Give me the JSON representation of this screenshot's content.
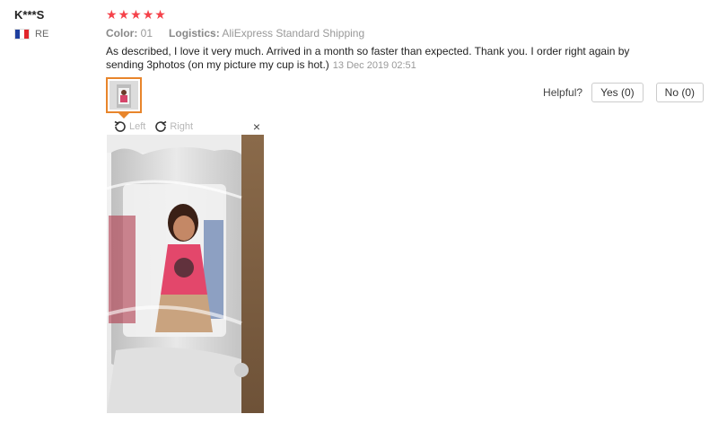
{
  "review": {
    "reviewer_name": "K***S",
    "country_code": "RE",
    "flag_colors": [
      "#1f3f9e",
      "#ffffff",
      "#e1252b"
    ],
    "rating": 5,
    "stars": [
      "★",
      "★",
      "★",
      "★",
      "★"
    ],
    "star_color": "#f5424a",
    "color_label": "Color:",
    "color_value": "01",
    "logistics_label": "Logistics:",
    "logistics_value": "AliExpress Standard Shipping",
    "feedback_text": "As described, I love it very much. Arrived in a month so faster than expected. Thank you. I order right again by sending 3photos (on my picture my cup is hot.)",
    "date": "13 Dec 2019 02:51"
  },
  "helpful": {
    "label": "Helpful?",
    "yes": "Yes (0)",
    "no": "No (0)"
  },
  "viewer": {
    "rotate_left": "Left",
    "rotate_right": "Right",
    "close": "×"
  },
  "accent_color": "#e8852b"
}
